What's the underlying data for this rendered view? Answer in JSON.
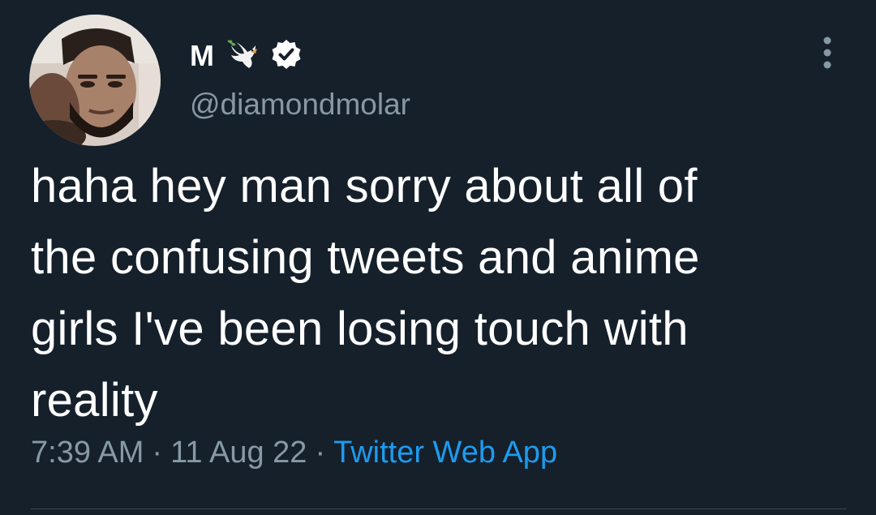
{
  "author": {
    "display_name": "M",
    "handle": "@diamondmolar",
    "avatar_icon": "profile-photo",
    "name_emoji_icon": "dove-icon",
    "verified_icon": "verified-badge-icon"
  },
  "tweet": {
    "text": "haha hey man sorry about all of\nthe confusing tweets and anime\ngirls I've been losing touch with\nreality"
  },
  "meta": {
    "time": "7:39 AM",
    "separator": "·",
    "date": "11 Aug 22",
    "source": "Twitter Web App"
  },
  "colors": {
    "background": "#15202b",
    "primary_text": "#ffffff",
    "secondary_text": "#8899a6",
    "link": "#1d9bf0",
    "divider": "#38444d"
  }
}
